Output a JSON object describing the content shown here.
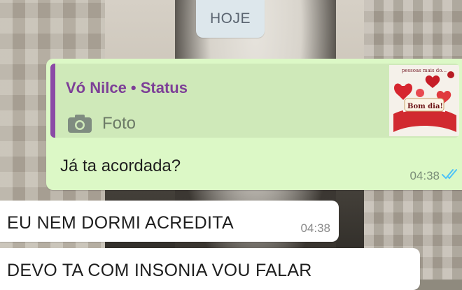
{
  "date_chip": {
    "label": "HOJE"
  },
  "messages": [
    {
      "direction": "outgoing",
      "quote": {
        "author": "Vó Nilce • Status",
        "media_icon": "camera-icon",
        "media_label": "Foto",
        "thumbnail_caption": "pessoas mais do...",
        "thumbnail_text": "Bom dia!"
      },
      "text": "Já ta acordada?",
      "time": "04:38",
      "status_icon": "double-check-icon",
      "status_color": "#4fc3f7"
    },
    {
      "direction": "incoming",
      "text": "EU NEM DORMI ACREDITA",
      "time": "04:38"
    },
    {
      "direction": "incoming",
      "text": "DEVO TA COM INSONIA VOU FALAR"
    }
  ],
  "colors": {
    "outgoing_bubble": "#dcf8c6",
    "incoming_bubble": "#ffffff",
    "quote_accent": "#8b4aa6",
    "date_chip": "#dde7ec"
  }
}
